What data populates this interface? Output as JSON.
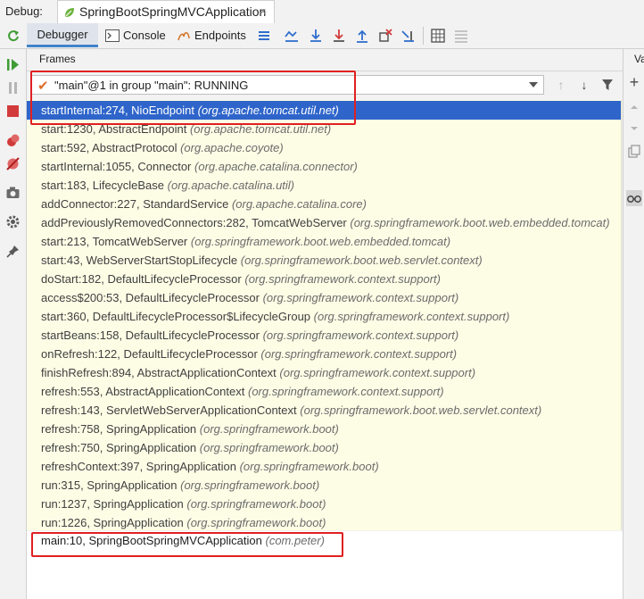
{
  "top_bar": {
    "debug_label": "Debug:",
    "session_tab": "SpringBootSpringMVCApplication",
    "close_glyph": "×"
  },
  "toolbar": {
    "tabs": [
      "Debugger",
      "Console",
      "Endpoints"
    ],
    "active_tab": "Debugger"
  },
  "frames_panel": {
    "title": "Frames",
    "thread_select_value": "\"main\"@1 in group \"main\": RUNNING",
    "frames": [
      {
        "method": "startInternal:274, NioEndpoint",
        "package": "(org.apache.tomcat.util.net)",
        "selected": true
      },
      {
        "method": "start:1230, AbstractEndpoint",
        "package": "(org.apache.tomcat.util.net)"
      },
      {
        "method": "start:592, AbstractProtocol",
        "package": "(org.apache.coyote)"
      },
      {
        "method": "startInternal:1055, Connector",
        "package": "(org.apache.catalina.connector)"
      },
      {
        "method": "start:183, LifecycleBase",
        "package": "(org.apache.catalina.util)"
      },
      {
        "method": "addConnector:227, StandardService",
        "package": "(org.apache.catalina.core)"
      },
      {
        "method": "addPreviouslyRemovedConnectors:282, TomcatWebServer",
        "package": "(org.springframework.boot.web.embedded.tomcat)"
      },
      {
        "method": "start:213, TomcatWebServer",
        "package": "(org.springframework.boot.web.embedded.tomcat)"
      },
      {
        "method": "start:43, WebServerStartStopLifecycle",
        "package": "(org.springframework.boot.web.servlet.context)"
      },
      {
        "method": "doStart:182, DefaultLifecycleProcessor",
        "package": "(org.springframework.context.support)"
      },
      {
        "method": "access$200:53, DefaultLifecycleProcessor",
        "package": "(org.springframework.context.support)"
      },
      {
        "method": "start:360, DefaultLifecycleProcessor$LifecycleGroup",
        "package": "(org.springframework.context.support)"
      },
      {
        "method": "startBeans:158, DefaultLifecycleProcessor",
        "package": "(org.springframework.context.support)"
      },
      {
        "method": "onRefresh:122, DefaultLifecycleProcessor",
        "package": "(org.springframework.context.support)"
      },
      {
        "method": "finishRefresh:894, AbstractApplicationContext",
        "package": "(org.springframework.context.support)"
      },
      {
        "method": "refresh:553, AbstractApplicationContext",
        "package": "(org.springframework.context.support)"
      },
      {
        "method": "refresh:143, ServletWebServerApplicationContext",
        "package": "(org.springframework.boot.web.servlet.context)"
      },
      {
        "method": "refresh:758, SpringApplication",
        "package": "(org.springframework.boot)"
      },
      {
        "method": "refresh:750, SpringApplication",
        "package": "(org.springframework.boot)"
      },
      {
        "method": "refreshContext:397, SpringApplication",
        "package": "(org.springframework.boot)"
      },
      {
        "method": "run:315, SpringApplication",
        "package": "(org.springframework.boot)"
      },
      {
        "method": "run:1237, SpringApplication",
        "package": "(org.springframework.boot)"
      },
      {
        "method": "run:1226, SpringApplication",
        "package": "(org.springframework.boot)"
      }
    ],
    "main_frame": {
      "method": "main:10, SpringBootSpringMVCApplication",
      "package": "(com.peter)"
    }
  },
  "variables_panel": {
    "label": "Va"
  },
  "colors": {
    "selection": "#2f65ca",
    "library_frames_bg": "#fdfde6",
    "annotation": "#e02020",
    "active_tab_underline": "#4083c9"
  },
  "icons": {
    "toolbar": [
      "rerun-icon",
      "console-icon",
      "endpoints-icon",
      "menu-icon",
      "show-execution-point-icon",
      "step-over-icon",
      "step-into-icon",
      "force-step-into-icon",
      "step-out-icon",
      "drop-frame-icon",
      "run-to-cursor-icon",
      "evaluate-expression-icon",
      "trace-icon"
    ],
    "left": [
      "resume-icon",
      "pause-icon",
      "stop-icon",
      "view-breakpoints-icon",
      "mute-breakpoints-icon",
      "camera-icon",
      "settings-icon",
      "pin-icon"
    ],
    "right": [
      "add-icon",
      "up-icon",
      "down-icon",
      "copy-icon",
      "glasses-icon"
    ]
  }
}
